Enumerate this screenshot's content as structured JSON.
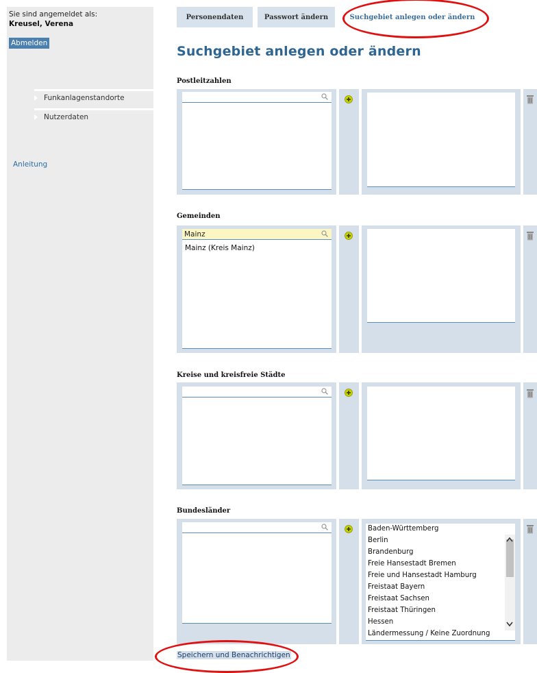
{
  "sidebar": {
    "login_label": "Sie sind angemeldet als:",
    "user_name": "Kreusel, Verena",
    "logout_label": "Abmelden",
    "nav_items": [
      {
        "label": "Funkanlagenstandorte"
      },
      {
        "label": "Nutzerdaten"
      }
    ],
    "help_label": "Anleitung"
  },
  "tabs": [
    {
      "label": "Personendaten",
      "active": false
    },
    {
      "label": "Passwort ändern",
      "active": false
    },
    {
      "label": "Suchgebiet anlegen oder ändern",
      "active": true
    }
  ],
  "page_title": "Suchgebiet anlegen oder ändern",
  "sections": [
    {
      "title": "Postleitzahlen",
      "search_value": "",
      "suggestions": [],
      "selected": []
    },
    {
      "title": "Gemeinden",
      "search_value": "Mainz",
      "suggestions": [
        "Mainz (Kreis Mainz)"
      ],
      "selected": []
    },
    {
      "title": "Kreise und kreisfreie Städte",
      "search_value": "",
      "suggestions": [],
      "selected": []
    },
    {
      "title": "Bundesländer",
      "search_value": "",
      "suggestions": [],
      "selected": [
        "Baden-Württemberg",
        "Berlin",
        "Brandenburg",
        "Freie Hansestadt Bremen",
        "Freie und Hansestadt Hamburg",
        "Freistaat Bayern",
        "Freistaat Sachsen",
        "Freistaat Thüringen",
        "Hessen",
        "Ländermessung / Keine Zuordnung"
      ]
    }
  ],
  "save_label": "Speichern und Benachrichtigen",
  "colors": {
    "accent": "#2f6591",
    "panel": "#d4dfe9",
    "sidebar": "#ececec",
    "annotation": "#e01010",
    "add_icon": "#c8d400"
  },
  "icons": {
    "search": "magnifier-icon",
    "add": "plus-circle-icon",
    "delete": "trash-icon"
  }
}
